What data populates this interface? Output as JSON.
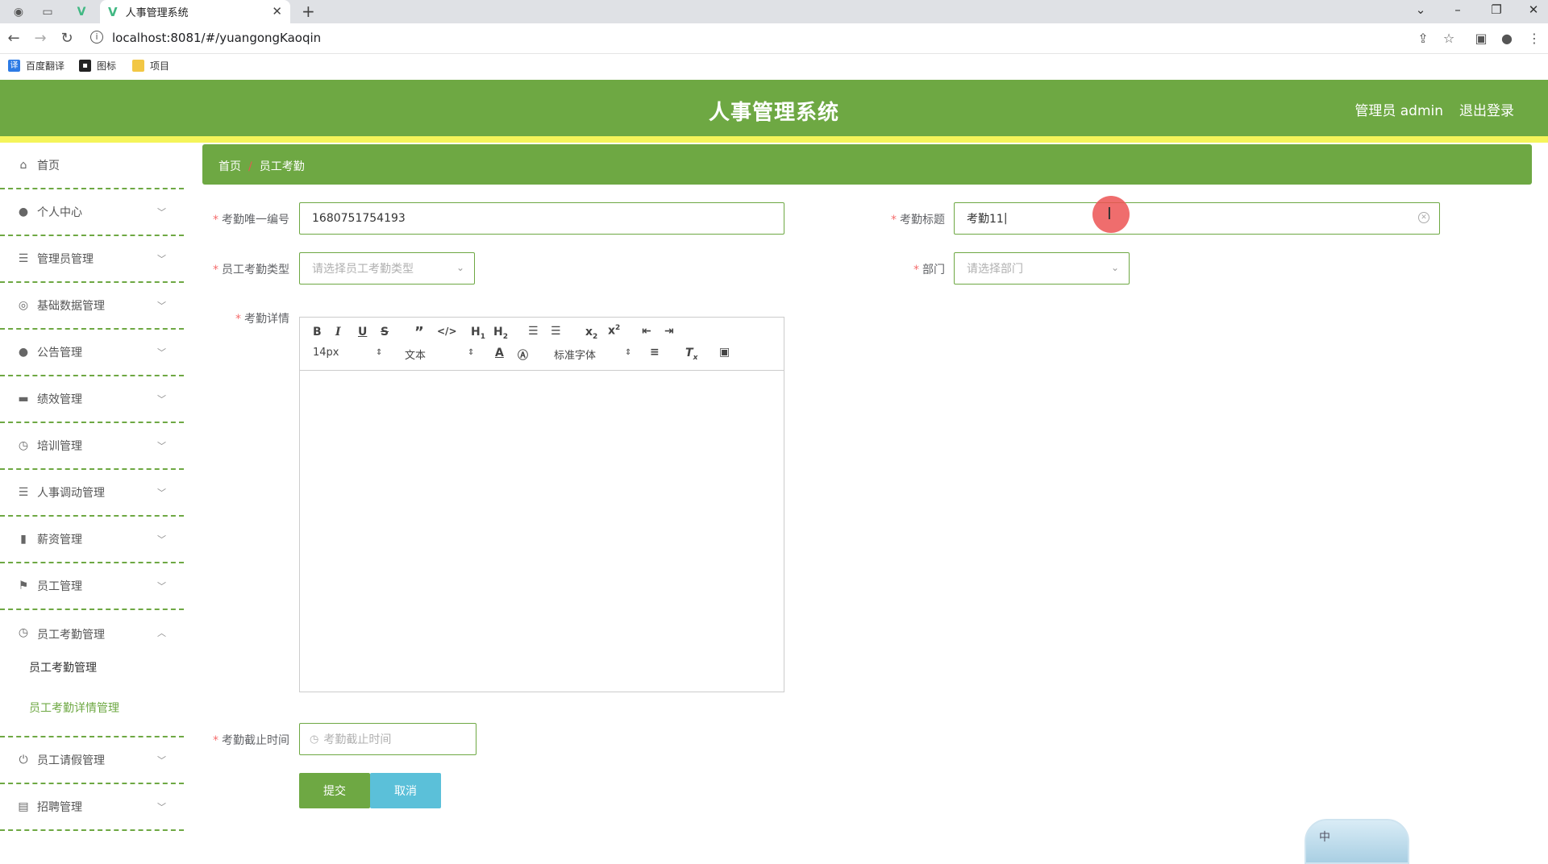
{
  "browser": {
    "tab_title": "人事管理系统",
    "url": "localhost:8081/#/yuangongKaoqin",
    "bookmarks": [
      "百度翻译",
      "图标",
      "项目"
    ]
  },
  "header": {
    "title": "人事管理系统",
    "user": "管理员 admin",
    "logout": "退出登录"
  },
  "sidebar": {
    "items": [
      {
        "label": "首页",
        "icon": "home-icon"
      },
      {
        "label": "个人中心",
        "icon": "user-icon"
      },
      {
        "label": "管理员管理",
        "icon": "list-icon"
      },
      {
        "label": "基础数据管理",
        "icon": "settings-icon"
      },
      {
        "label": "公告管理",
        "icon": "pin-icon"
      },
      {
        "label": "绩效管理",
        "icon": "chat-icon"
      },
      {
        "label": "培训管理",
        "icon": "compass-icon"
      },
      {
        "label": "人事调动管理",
        "icon": "list-icon"
      },
      {
        "label": "薪资管理",
        "icon": "bar-chart-icon"
      },
      {
        "label": "员工管理",
        "icon": "flag-icon"
      },
      {
        "label": "员工考勤管理",
        "icon": "clock-icon"
      },
      {
        "label": "员工请假管理",
        "icon": "power-icon"
      },
      {
        "label": "招聘管理",
        "icon": "card-icon"
      }
    ],
    "sub_items": [
      "员工考勤管理",
      "员工考勤详情管理"
    ]
  },
  "breadcrumb": {
    "home": "首页",
    "sep": "/",
    "current": "员工考勤"
  },
  "form": {
    "code_label": "考勤唯一编号",
    "code_value": "1680751754193",
    "title_label": "考勤标题",
    "title_value": "考勤11",
    "type_label": "员工考勤类型",
    "type_placeholder": "请选择员工考勤类型",
    "dept_label": "部门",
    "dept_placeholder": "请选择部门",
    "detail_label": "考勤详情",
    "deadline_label": "考勤截止时间",
    "deadline_placeholder": "考勤截止时间",
    "submit": "提交",
    "cancel": "取消"
  },
  "editor": {
    "font_size": "14px",
    "header_select": "文本",
    "font_family": "标准字体"
  },
  "ime": {
    "label": "中"
  }
}
